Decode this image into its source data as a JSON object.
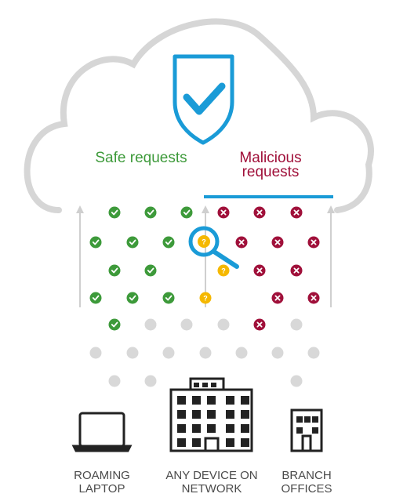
{
  "labels": {
    "safe": "Safe requests",
    "malicious": "Malicious requests"
  },
  "devices": [
    {
      "id": "roaming-laptop",
      "label": "ROAMING LAPTOP",
      "icon": "laptop-icon"
    },
    {
      "id": "any-device",
      "label": "ANY DEVICE ON NETWORK",
      "icon": "office-building-icon"
    },
    {
      "id": "branch-offices",
      "label": "BRANCH OFFICES",
      "icon": "branch-building-icon"
    }
  ],
  "colors": {
    "cloud": "#d6d6d6",
    "shield": "#1a9bd7",
    "safe": "#3d9a3a",
    "malicious": "#a0103a",
    "suspicious": "#f5b800",
    "neutral": "#d8d8d8",
    "arrow": "#cfcfcf",
    "building": "#222222"
  },
  "icons": {
    "shield": "shield-check-icon",
    "magnifier": "magnifier-icon",
    "safe": "check-circle-icon",
    "malicious": "x-circle-icon",
    "suspicious": "question-circle-icon"
  }
}
